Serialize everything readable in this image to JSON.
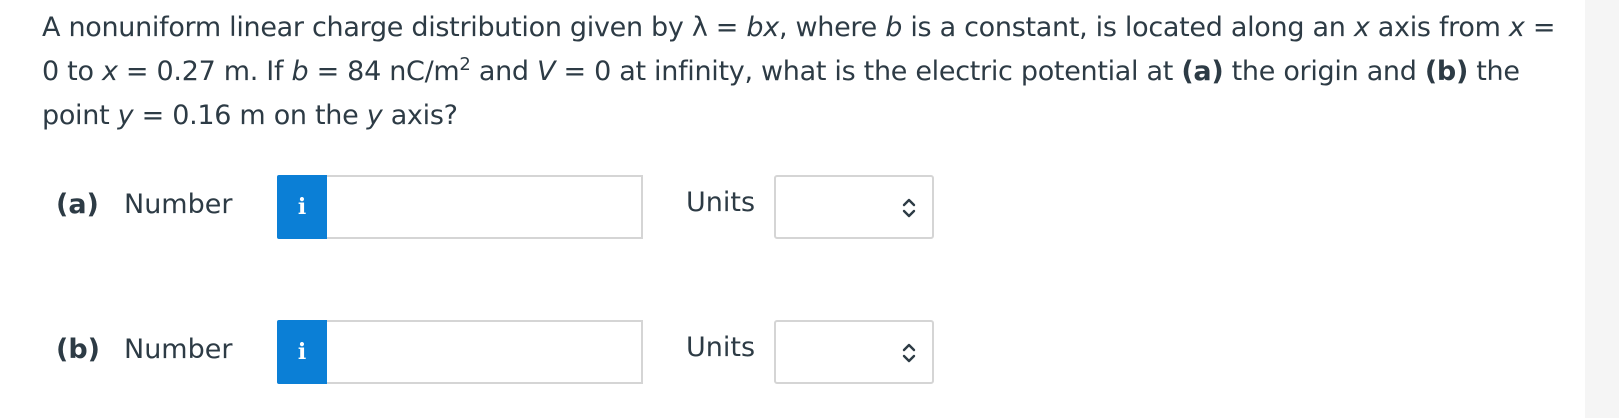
{
  "question": {
    "segments": [
      {
        "t": "A nonuniform linear charge distribution given by λ = ",
        "s": ""
      },
      {
        "t": "bx",
        "s": "i"
      },
      {
        "t": ", where ",
        "s": ""
      },
      {
        "t": "b",
        "s": "i"
      },
      {
        "t": " is a constant, is located along an ",
        "s": ""
      },
      {
        "t": "x",
        "s": "i"
      },
      {
        "t": " axis from ",
        "s": ""
      },
      {
        "t": "x",
        "s": "i"
      },
      {
        "t": " = 0 to ",
        "s": ""
      },
      {
        "t": "x",
        "s": "i"
      },
      {
        "t": " = 0.27 m. If ",
        "s": ""
      },
      {
        "t": "b",
        "s": "i"
      },
      {
        "t": " = 84 nC/m",
        "s": ""
      },
      {
        "t": "2",
        "s": "sup"
      },
      {
        "t": " and ",
        "s": ""
      },
      {
        "t": "V",
        "s": "i"
      },
      {
        "t": " = 0 at infinity, what is the electric potential at ",
        "s": ""
      },
      {
        "t": "(a)",
        "s": "b"
      },
      {
        "t": " the origin and ",
        "s": ""
      },
      {
        "t": "(b)",
        "s": "b"
      },
      {
        "t": " the point ",
        "s": ""
      },
      {
        "t": "y",
        "s": "i"
      },
      {
        "t": " = 0.16 m on the ",
        "s": ""
      },
      {
        "t": "y",
        "s": "i"
      },
      {
        "t": " axis?",
        "s": ""
      }
    ]
  },
  "parts": [
    {
      "label": "(a)",
      "number_label": "Number",
      "info_icon": "i",
      "number_value": "",
      "units_label": "Units",
      "units_selected": ""
    },
    {
      "label": "(b)",
      "number_label": "Number",
      "info_icon": "i",
      "number_value": "",
      "units_label": "Units",
      "units_selected": ""
    }
  ],
  "colors": {
    "text": "#2d3b45",
    "info_button": "#0b7fd6",
    "border": "#d5d5d5"
  },
  "icons": {
    "info": "info-icon",
    "select": "updown-chevron-icon"
  }
}
